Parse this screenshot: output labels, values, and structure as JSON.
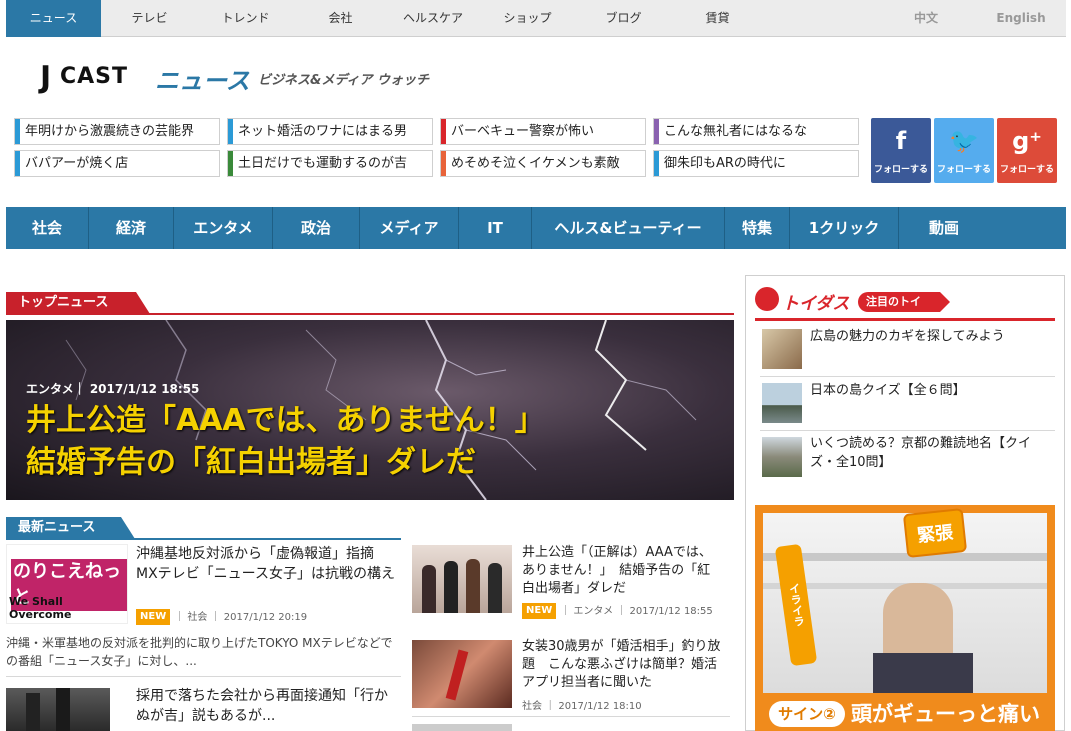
{
  "topnav": {
    "items": [
      "ニュース",
      "テレビ",
      "トレンド",
      "会社",
      "ヘルスケア",
      "ショップ",
      "ブログ",
      "賃貸"
    ],
    "langs": [
      "中文",
      "English"
    ]
  },
  "logo": {
    "j": "J",
    "cast": "CAST",
    "news": "ニュース",
    "tagline": "ビジネス&メディア ウォッチ"
  },
  "headlines": [
    {
      "text": "年明けから激震続きの芸能界",
      "color": "#2b9ad6"
    },
    {
      "text": "ネット婚活のワナにはまる男",
      "color": "#2b9ad6"
    },
    {
      "text": "バーベキュー警察が怖い",
      "color": "#d9252b"
    },
    {
      "text": "こんな無礼者にはなるな",
      "color": "#8a62b0"
    },
    {
      "text": "バパアーが焼く店",
      "color": "#2b9ad6"
    },
    {
      "text": "土日だけでも運動するのが吉",
      "color": "#3a8a3a"
    },
    {
      "text": "めそめそ泣くイケメンも素敵",
      "color": "#e8633a"
    },
    {
      "text": "御朱印もARの時代に",
      "color": "#2b9ad6"
    }
  ],
  "social": [
    {
      "symbol": "f",
      "label": "フォローする",
      "color": "#3b5998",
      "icon": "facebook-icon"
    },
    {
      "symbol": "🐦",
      "label": "フォローする",
      "color": "#55acee",
      "icon": "twitter-icon"
    },
    {
      "symbol": "g⁺",
      "label": "フォローする",
      "color": "#dd4b39",
      "icon": "google-plus-icon"
    }
  ],
  "categories": [
    "社会",
    "経済",
    "エンタメ",
    "政治",
    "メディア",
    "IT",
    "ヘルス&ビューティー",
    "特集",
    "1クリック",
    "動画"
  ],
  "top_news": {
    "label": "トップニュース",
    "meta": "エンタメ｜ 2017/1/12 18:55",
    "title_line1": "井上公造「AAAでは、ありません！」",
    "title_line2": "結婚予告の「紅白出場者」ダレだ"
  },
  "latest": {
    "label": "最新ニュース",
    "items": [
      {
        "title": "沖縄基地反対派から「虚偽報道」指摘　MXテレビ「ニュース女子」は抗戦の構え",
        "new": "NEW",
        "category": "社会",
        "date": "2017/1/12 20:19",
        "excerpt": "沖縄・米軍基地の反対派を批判的に取り上げたTOKYO MXテレビなどでの番組「ニュース女子」に対し、...",
        "thumb_text": "のりこえねっと",
        "thumb_sub": "We Shall Overcome"
      },
      {
        "title": "井上公造「（正解は）AAAでは、ありません！」　結婚予告の「紅白出場者」ダレだ",
        "new": "NEW",
        "category": "エンタメ",
        "date": "2017/1/12 18:55"
      },
      {
        "title": "採用で落ちた会社から再面接通知「行かぬが吉」説もあるが...",
        "category": "",
        "date": ""
      },
      {
        "title": "女装30歳男が「婚活相手」釣り放題　こんな悪ふざけは簡単？婚活アプリ担当者に聞いた",
        "category": "社会",
        "date": "2017/1/12 18:10"
      }
    ]
  },
  "toidas": {
    "brand": "トイダス",
    "tag": "注目のトイ",
    "items": [
      {
        "title": "広島の魅力のカギを探してみよう"
      },
      {
        "title": "日本の島クイズ【全６問】"
      },
      {
        "title": "いくつ読める？京都の難読地名【クイズ・全10問】"
      }
    ]
  },
  "ad": {
    "tag_top": "緊張",
    "tag_side": "イライラ",
    "sign": "サイン②",
    "caption": "頭がギューっと痛い"
  }
}
